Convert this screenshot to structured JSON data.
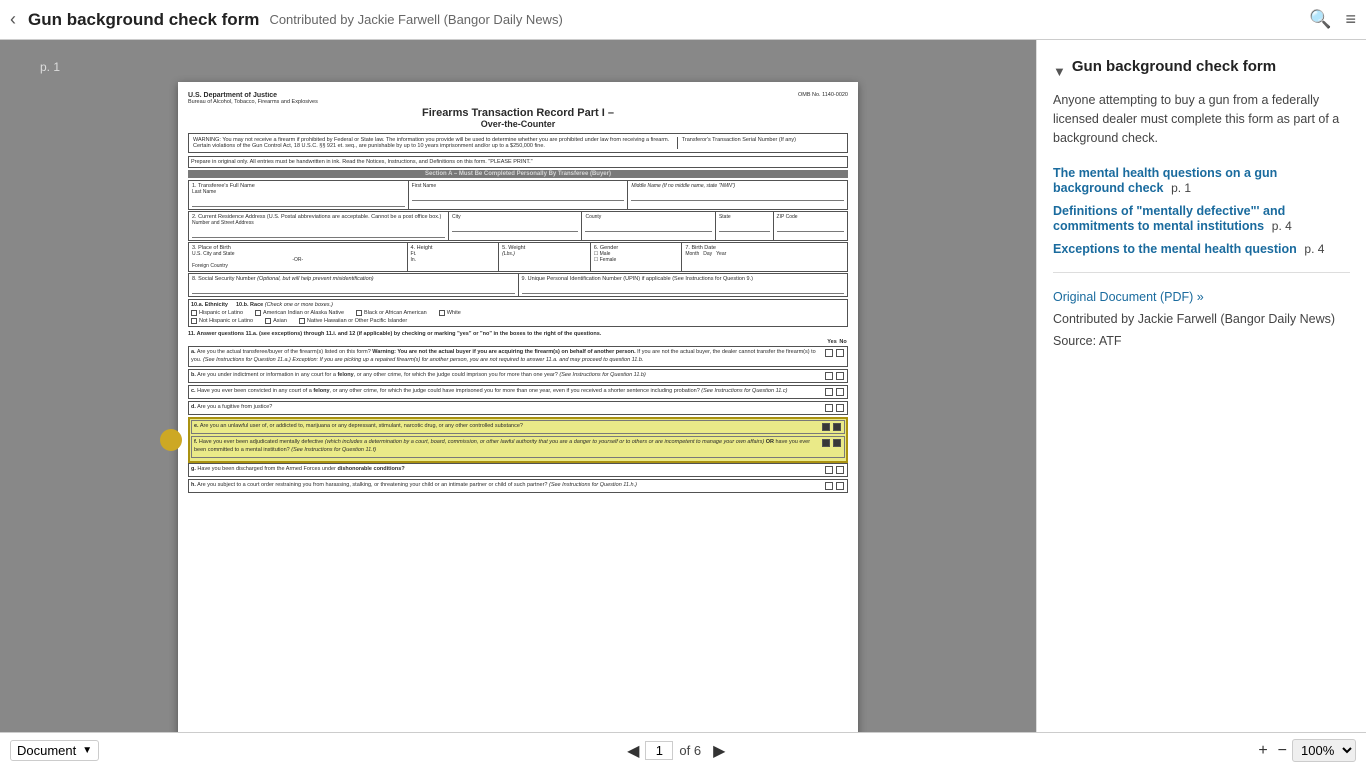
{
  "topbar": {
    "back_label": "‹",
    "title": "Gun background check form",
    "subtitle": "Contributed by Jackie Farwell (Bangor Daily News)",
    "search_icon": "🔍",
    "menu_icon": "≡"
  },
  "viewer": {
    "page_label": "p. 1"
  },
  "sidebar": {
    "title": "Gun background check form",
    "description": "Anyone attempting to buy a gun from a federally licensed dealer must complete this form as part of a background check.",
    "links": [
      {
        "text": "The mental health questions on a gun background check",
        "page": "p. 1"
      },
      {
        "text": "Definitions of \"mentally defective\"' and commitments to mental institutions",
        "page": "p. 4"
      },
      {
        "text": "Exceptions to the mental health question",
        "page": "p. 4"
      }
    ],
    "original_doc": "Original Document (PDF) »",
    "contributed": "Contributed by Jackie Farwell (Bangor Daily News)",
    "source": "Source: ATF"
  },
  "bottombar": {
    "doc_type": "Document",
    "prev_icon": "◀",
    "next_icon": "▶",
    "current_page": "1",
    "total_pages": "of 6",
    "zoom_in": "+",
    "zoom_out": "−",
    "zoom_level": "100%"
  },
  "document": {
    "omg": "OMB No. 1140-0020",
    "agency": "U.S. Department of Justice",
    "bureau": "Bureau of Alcohol, Tobacco, Firearms and Explosives",
    "title": "Firearms Transaction Record Part I –",
    "subtitle": "Over-the-Counter",
    "warning": "WARNING: You may not receive a firearm if prohibited by Federal or State law. The information you provide will be used to determine whether you are prohibited under law from receiving a firearm. Certain violations of the Gun Control Act, 18 U.S.C. §§ 921 et. seq., are punishable by up to 10 years imprisonment and/or up to a $250,000 fine.",
    "serial_label": "Transferor's Transaction Serial Number (If any)",
    "prepare_note": "Prepare in original only. All entries must be handwritten in ink. Read the Notices, Instructions, and Definitions on this form. \"PLEASE PRINT.\"",
    "section_a": "Section A – Must Be Completed Personally By Transferee (Buyer)",
    "q11_header": "11. Answer questions 11.a. (see exceptions) through 11.i. and 12 (if applicable) by checking or marking \"yes\" or \"no\" in the boxes to the right of the questions.",
    "questions": [
      {
        "id": "a",
        "text": "Are you the actual transferee/buyer of the firearm(s) listed on this form? Warning: You are not the actual buyer if you are acquiring the firearm(s) on behalf of another person. If you are not the actual buyer, the dealer cannot transfer the firearm(s) to you. (See Instructions for Question 11.a.) Exception: If you are picking up a repaired firearm(s) for another person, you are not required to answer 11.a. and may proceed to question 11.b.",
        "highlight": false
      },
      {
        "id": "b",
        "text": "Are you under indictment or information in any court for a felony, or any other crime, for which the judge could imprison you for more than one year? (See Instructions for Question 11.b)",
        "highlight": false
      },
      {
        "id": "c",
        "text": "Have you ever been convicted in any court of a felony, or any other crime, for which the judge could have imprisoned you for more than one year, even if you received a shorter sentence including probation? (See Instructions for Question 11.c)",
        "highlight": false
      },
      {
        "id": "d",
        "text": "Are you a fugitive from justice?",
        "highlight": false
      },
      {
        "id": "e",
        "text": "Are you an unlawful user of, or addicted to, marijuana or any depressant, stimulant, narcotic drug, or any other controlled substance?",
        "highlight": true
      },
      {
        "id": "f",
        "text": "Have you ever been adjudicated mentally defective (which includes a determination by a court, board, commission, or other lawful authority that you are a danger to yourself or to others or are incompetent to manage your own affairs) OR have you ever been committed to a mental institution? (See Instructions for Question 11.f)",
        "highlight": true
      },
      {
        "id": "g",
        "text": "Have you been discharged from the Armed Forces under dishonorable conditions?",
        "highlight": false
      },
      {
        "id": "h",
        "text": "Are you subject to a court order restraining you from harassing, stalking, or threatening your child or an intimate partner or child of such partner? (See Instructions for Question 11.h.)",
        "highlight": false
      }
    ]
  }
}
